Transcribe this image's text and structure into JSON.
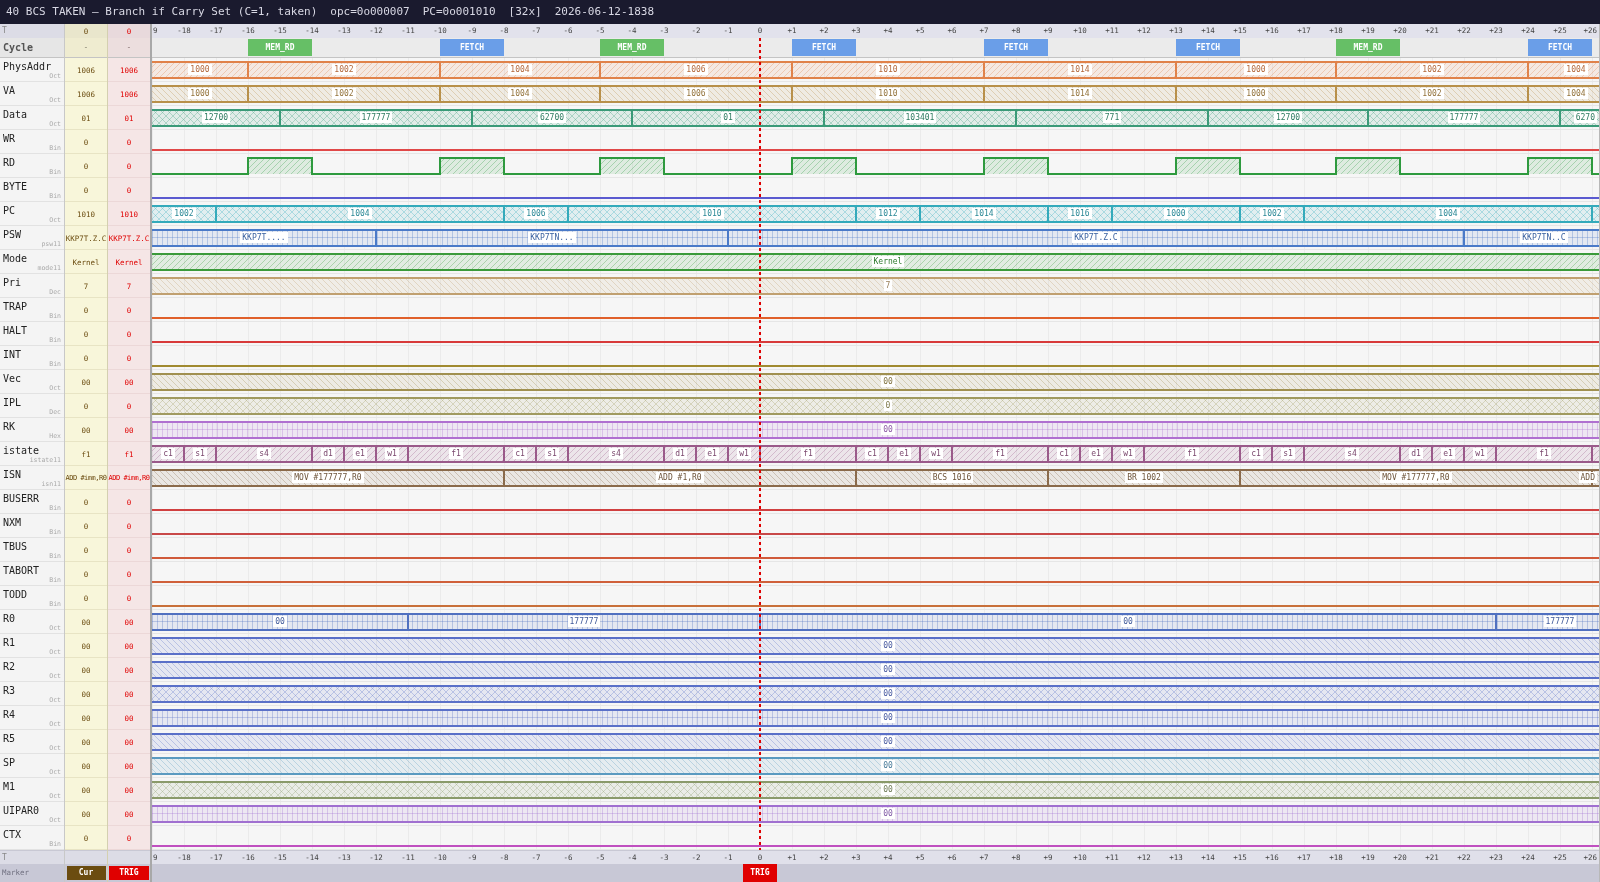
{
  "title_bar": {
    "title": "40 BCS TAKEN — Branch if Carry Set (C=1, taken)",
    "opcode": "opc=0o000007",
    "pc": "PC=0o001010",
    "zoom": "[32x]",
    "timestamp": "2026-06-12-1838"
  },
  "header": {
    "label": "T",
    "cur": "0",
    "trig": "0"
  },
  "time_axis": {
    "ticks": [
      "9",
      "-18",
      "-17",
      "-16",
      "-15",
      "-14",
      "-13",
      "-12",
      "-11",
      "-10",
      "-9",
      "-8",
      "-7",
      "-6",
      "-5",
      "-4",
      "-3",
      "-2",
      "-1",
      "0",
      "+1",
      "+2",
      "+3",
      "+4",
      "+5",
      "+6",
      "+7",
      "+8",
      "+9",
      "+10",
      "+11",
      "+12",
      "+13",
      "+14",
      "+15",
      "+16",
      "+17",
      "+18",
      "+19",
      "+20",
      "+21",
      "+22",
      "+23",
      "+24",
      "+25",
      "+26"
    ]
  },
  "cycle_row": {
    "name": "Cycle",
    "cur": "-",
    "trig": "-",
    "phases": [
      {
        "label": "MEM_RD",
        "color": "#66bf66"
      },
      {
        "label": "FETCH",
        "color": "#6a9ee8"
      },
      {
        "label": "MEM_RD",
        "color": "#66bf66"
      },
      {
        "label": "FETCH",
        "color": "#6a9ee8"
      },
      {
        "label": "FETCH",
        "color": "#6a9ee8"
      },
      {
        "label": "FETCH",
        "color": "#6a9ee8"
      },
      {
        "label": "MEM_RD",
        "color": "#66bf66"
      },
      {
        "label": "FETCH",
        "color": "#6a9ee8"
      }
    ]
  },
  "signals": [
    {
      "name": "PhysAddr",
      "radix": "Oct",
      "cur": "1006",
      "trig": "1006",
      "kind": "bus",
      "color": "#e0824a",
      "values": [
        "1000",
        "1002",
        "1004",
        "1006",
        "1010",
        "1014",
        "1000",
        "1002",
        "1004"
      ]
    },
    {
      "name": "VA",
      "radix": "Oct",
      "cur": "1006",
      "trig": "1006",
      "kind": "bus",
      "color": "#b8904a",
      "values": [
        "1000",
        "1002",
        "1004",
        "1006",
        "1010",
        "1014",
        "1000",
        "1002",
        "1004"
      ]
    },
    {
      "name": "Data",
      "radix": "Oct",
      "cur": "01",
      "trig": "01",
      "kind": "bus",
      "color": "#3a9a78",
      "values": [
        "12700",
        "177777",
        "62700",
        "01",
        "103401",
        "771",
        "12700",
        "177777",
        "6270"
      ]
    },
    {
      "name": "WR",
      "radix": "Bin",
      "cur": "0",
      "trig": "0",
      "kind": "bit",
      "color": "#e04848"
    },
    {
      "name": "RD",
      "radix": "Bin",
      "cur": "0",
      "trig": "0",
      "kind": "bit",
      "color": "#2e9a3e"
    },
    {
      "name": "BYTE",
      "radix": "Bin",
      "cur": "0",
      "trig": "0",
      "kind": "bit",
      "color": "#5a5ad0"
    },
    {
      "name": "PC",
      "radix": "Oct",
      "cur": "1010",
      "trig": "1010",
      "kind": "bus",
      "color": "#34aabb",
      "values": [
        "1002",
        "1004",
        "1006",
        "1010",
        "1012",
        "1014",
        "1016",
        "1000",
        "1002",
        "1004"
      ]
    },
    {
      "name": "PSW",
      "radix": "psw11",
      "cur": "KKP7T.Z.C",
      "trig": "KKP7T.Z.C",
      "kind": "bus",
      "color": "#4a7ac8",
      "values": [
        "KKP7T....",
        "KKP7TN...",
        "KKP7T.Z.C",
        "KKP7TN..C"
      ]
    },
    {
      "name": "Mode",
      "radix": "mode11",
      "cur": "Kernel",
      "trig": "Kernel",
      "kind": "bus",
      "color": "#3a9a3a",
      "values": [
        "Kernel"
      ]
    },
    {
      "name": "Pri",
      "radix": "Dec",
      "cur": "7",
      "trig": "7",
      "kind": "bus",
      "color": "#c0a070",
      "values": [
        "7"
      ]
    },
    {
      "name": "TRAP",
      "radix": "Bin",
      "cur": "0",
      "trig": "0",
      "kind": "bit",
      "color": "#e0602a"
    },
    {
      "name": "HALT",
      "radix": "Bin",
      "cur": "0",
      "trig": "0",
      "kind": "bit",
      "color": "#d83a3a"
    },
    {
      "name": "INT",
      "radix": "Bin",
      "cur": "0",
      "trig": "0",
      "kind": "bit",
      "color": "#a08a30"
    },
    {
      "name": "Vec",
      "radix": "Oct",
      "cur": "00",
      "trig": "00",
      "kind": "bus",
      "color": "#a09050",
      "values": [
        "00"
      ]
    },
    {
      "name": "IPL",
      "radix": "Dec",
      "cur": "0",
      "trig": "0",
      "kind": "bus",
      "color": "#a09a60",
      "values": [
        "0"
      ]
    },
    {
      "name": "RK",
      "radix": "Hex",
      "cur": "00",
      "trig": "00",
      "kind": "bus",
      "color": "#b070d0",
      "values": [
        "00"
      ]
    },
    {
      "name": "istate",
      "radix": "istate11",
      "cur": "f1",
      "trig": "f1",
      "kind": "bus",
      "color": "#9a5a8a",
      "values": [
        "c1",
        "s1",
        "s4",
        "d1",
        "e1",
        "w1",
        "f1",
        "c1",
        "s1",
        "s4",
        "d1",
        "e1",
        "w1",
        "f1",
        "c1",
        "e1",
        "w1",
        "f1",
        "c1",
        "e1",
        "w1",
        "f1",
        "c1",
        "s1",
        "s4",
        "d1",
        "e1",
        "w1",
        "f1"
      ]
    },
    {
      "name": "ISN",
      "radix": "isn11",
      "cur": "ADD #imm,R0",
      "trig": "ADD #imm,R0",
      "kind": "bus",
      "color": "#8a6a4a",
      "values": [
        "MOV #177777,R0",
        "ADD #1,R0",
        "BCS 1016",
        "BR 1002",
        "MOV #177777,R0",
        "ADD"
      ]
    },
    {
      "name": "BUSERR",
      "radix": "Bin",
      "cur": "0",
      "trig": "0",
      "kind": "bit",
      "color": "#d04040"
    },
    {
      "name": "NXM",
      "radix": "Bin",
      "cur": "0",
      "trig": "0",
      "kind": "bit",
      "color": "#c84848"
    },
    {
      "name": "TBUS",
      "radix": "Bin",
      "cur": "0",
      "trig": "0",
      "kind": "bit",
      "color": "#d05a3a"
    },
    {
      "name": "TABORT",
      "radix": "Bin",
      "cur": "0",
      "trig": "0",
      "kind": "bit",
      "color": "#d0603a"
    },
    {
      "name": "TODD",
      "radix": "Bin",
      "cur": "0",
      "trig": "0",
      "kind": "bit",
      "color": "#c8703a"
    },
    {
      "name": "R0",
      "radix": "Oct",
      "cur": "00",
      "trig": "00",
      "kind": "bus",
      "color": "#5070c0",
      "values": [
        "00",
        "177777",
        "00",
        "177777"
      ]
    },
    {
      "name": "R1",
      "radix": "Oct",
      "cur": "00",
      "trig": "00",
      "kind": "bus",
      "color": "#5a70c8",
      "values": [
        "00"
      ]
    },
    {
      "name": "R2",
      "radix": "Oct",
      "cur": "00",
      "trig": "00",
      "kind": "bus",
      "color": "#5a70c8",
      "values": [
        "00"
      ]
    },
    {
      "name": "R3",
      "radix": "Oct",
      "cur": "00",
      "trig": "00",
      "kind": "bus",
      "color": "#5a70c8",
      "values": [
        "00"
      ]
    },
    {
      "name": "R4",
      "radix": "Oct",
      "cur": "00",
      "trig": "00",
      "kind": "bus",
      "color": "#5a70c8",
      "values": [
        "00"
      ]
    },
    {
      "name": "R5",
      "radix": "Oct",
      "cur": "00",
      "trig": "00",
      "kind": "bus",
      "color": "#5a70c8",
      "values": [
        "00"
      ]
    },
    {
      "name": "SP",
      "radix": "Oct",
      "cur": "00",
      "trig": "00",
      "kind": "bus",
      "color": "#5a9ac0",
      "values": [
        "00"
      ]
    },
    {
      "name": "M1",
      "radix": "Oct",
      "cur": "00",
      "trig": "00",
      "kind": "bus",
      "color": "#8a9a6a",
      "values": [
        "00"
      ]
    },
    {
      "name": "UIPAR0",
      "radix": "Oct",
      "cur": "00",
      "trig": "00",
      "kind": "bus",
      "color": "#a070d0",
      "values": [
        "00"
      ]
    },
    {
      "name": "CTX",
      "radix": "Bin",
      "cur": "0",
      "trig": "0",
      "kind": "bit",
      "color": "#c050c0"
    }
  ],
  "footer": {
    "label": "T",
    "ticks": [
      "9",
      "-18",
      "-17",
      "-16",
      "-15",
      "-14",
      "-13",
      "-12",
      "-11",
      "-10",
      "-9",
      "-8",
      "-7",
      "-6",
      "-5",
      "-4",
      "-3",
      "-2",
      "-1",
      "0",
      "+1",
      "+2",
      "+3",
      "+4",
      "+5",
      "+6",
      "+7",
      "+8",
      "+9",
      "+10",
      "+11",
      "+12",
      "+13",
      "+14",
      "+15",
      "+16",
      "+17",
      "+18",
      "+19",
      "+20",
      "+21",
      "+22",
      "+23",
      "+24",
      "+25",
      "+26"
    ]
  },
  "marker_bar": {
    "label": "Marker",
    "markers": [
      {
        "label": "Cur",
        "color": "#6b4c10"
      },
      {
        "label": "TRIG",
        "color": "#e00000"
      }
    ],
    "trigger_marker": {
      "label": "TRIG",
      "color": "#e00000"
    }
  }
}
